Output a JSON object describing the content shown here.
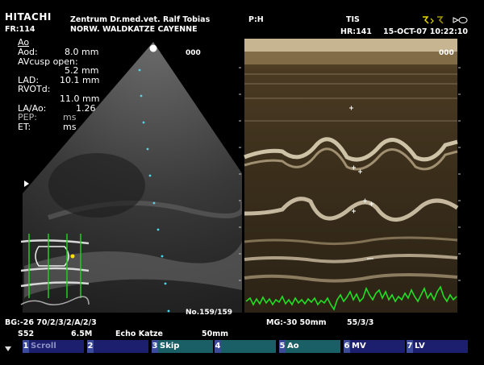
{
  "header": {
    "brand": "HITACHI",
    "frame_rate": "FR:114",
    "clinic_line1": "Zentrum Dr.med.vet. Ralf Tobias",
    "clinic_line2": "NORW. WALDKATZE  CAYENNE",
    "probe": "P:H",
    "mode": "TIS",
    "heart_rate": "HR:141",
    "datetime": "15-OCT-07 10:22:10"
  },
  "measurements": {
    "title": "Ao",
    "lines": [
      {
        "label": "Aod:",
        "value": "8.0 mm"
      },
      {
        "label": "AVcusp open:",
        "value": ""
      },
      {
        "label": "",
        "value": "5.2 mm"
      },
      {
        "label": "LAD:",
        "value": "10.1 mm"
      },
      {
        "label": "RVOTd:",
        "value": ""
      },
      {
        "label": "",
        "value": "11.0 mm"
      },
      {
        "label": "LA/Ao:",
        "value": "1.26"
      },
      {
        "label": "PEP:",
        "value": "ms"
      },
      {
        "label": "ET:",
        "value": "ms"
      }
    ]
  },
  "image": {
    "bmode_counter": "000",
    "mmode_counter": "000",
    "cine_index": "No.159/159"
  },
  "footer": {
    "left_line1": "BG:-26  70/2/3/2/A/2/3",
    "left_line2_a": "S52",
    "left_line2_b": "6.5M",
    "left_line2_c": "Echo Katze",
    "left_line2_d": "50mm",
    "mid_line1_a": "MG:-30  50mm",
    "mid_line1_b": "55/3/3"
  },
  "softkeys": [
    {
      "num": "1",
      "label": "Scroll",
      "enabled": false
    },
    {
      "num": "2",
      "label": "",
      "enabled": true
    },
    {
      "num": "3",
      "label": "Skip",
      "enabled": true
    },
    {
      "num": "4",
      "label": "",
      "enabled": true
    },
    {
      "num": "5",
      "label": "Ao",
      "enabled": true
    },
    {
      "num": "6",
      "label": "MV",
      "enabled": true
    },
    {
      "num": "7",
      "label": "LV",
      "enabled": true
    }
  ],
  "colors": {
    "background": "#000000",
    "ecg_trace": "#22dd22",
    "caliper": "#4fd6e8",
    "softkey_bg": "#1c1f6e",
    "softkey_active_bg": "#1a5f66"
  }
}
